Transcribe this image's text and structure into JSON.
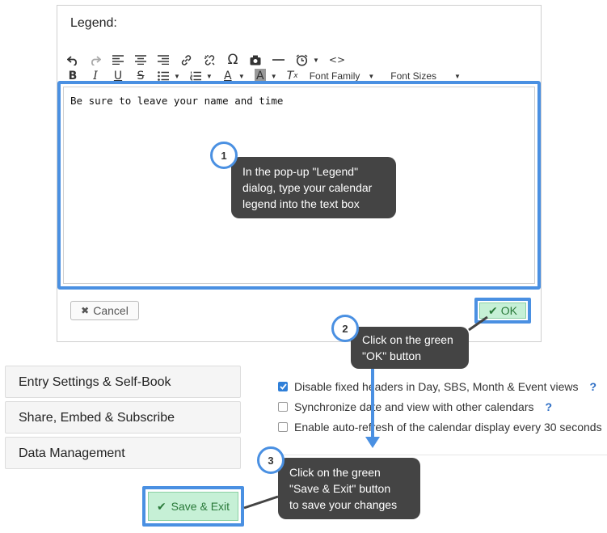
{
  "dialog": {
    "title": "Legend:",
    "editor_text": "Be sure to leave your name and time",
    "font_family_label": "Font Family",
    "font_sizes_label": "Font Sizes",
    "cancel_label": "Cancel",
    "ok_label": "OK"
  },
  "panels": [
    {
      "label": "Entry Settings & Self-Book"
    },
    {
      "label": "Share, Embed & Subscribe"
    },
    {
      "label": "Data Management"
    }
  ],
  "options": [
    {
      "label": "Disable fixed headers in Day, SBS, Month & Event views",
      "checked": true,
      "help": "?"
    },
    {
      "label": "Synchronize date and view with other calendars",
      "checked": false,
      "help": "?"
    },
    {
      "label": "Enable auto-refresh of the calendar display every 30 seconds",
      "checked": false
    }
  ],
  "save_exit_label": "Save & Exit",
  "callouts": [
    {
      "number": "1",
      "text": [
        "In the pop-up \"Legend\"",
        "dialog, type your calendar",
        "legend into the text box"
      ]
    },
    {
      "number": "2",
      "text": [
        "Click on the green",
        "\"OK\" button"
      ]
    },
    {
      "number": "3",
      "text": [
        "Click on the green",
        "\"Save & Exit\" button",
        "to save your changes"
      ]
    }
  ],
  "colors": {
    "highlight": "#4a90e2",
    "green_button": "#c6f0d6",
    "bubble": "#444444",
    "checkbox": "#2f7fd8"
  }
}
